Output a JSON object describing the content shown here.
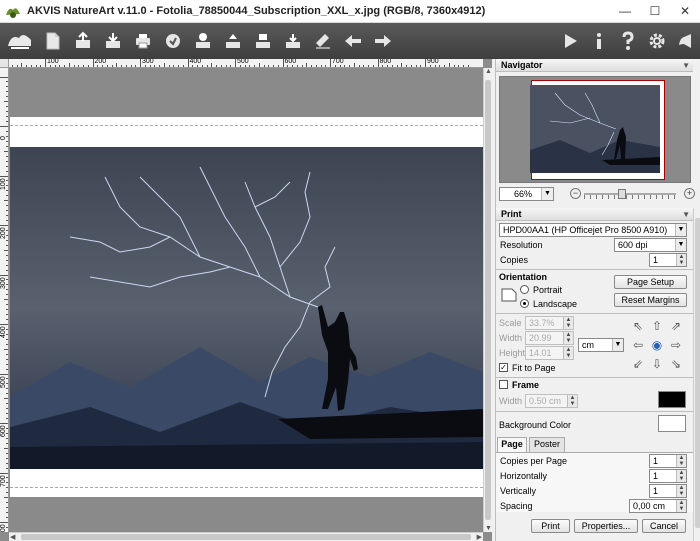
{
  "window": {
    "title": "AKVIS NatureArt v.11.0 - Fotolia_78850044_Subscription_XXL_x.jpg (RGB/8, 7360x4912)",
    "minimize": "—",
    "maximize": "☐",
    "close": "✕"
  },
  "toolbar": {
    "left_icons": [
      "open-icon",
      "save-icon",
      "batch-icon",
      "print-icon",
      "share-icon",
      "import-icon",
      "export-icon",
      "paste-icon",
      "copy-icon",
      "brush-settings-icon",
      "undo-arrow-icon",
      "redo-arrow-icon"
    ],
    "right_icons": [
      "run-icon",
      "info-icon",
      "help-icon",
      "settings-icon",
      "news-icon"
    ]
  },
  "ruler": {
    "h_labels": [
      "100",
      "200",
      "300",
      "400",
      "500",
      "600",
      "700",
      "800",
      "900"
    ],
    "v_labels": [
      "0",
      "100",
      "200",
      "300",
      "400",
      "500",
      "600",
      "700",
      "800"
    ]
  },
  "navigator": {
    "title": "Navigator",
    "zoom": "66%",
    "zoom_minus": "−",
    "zoom_plus": "+"
  },
  "print": {
    "title": "Print",
    "printer": "HPD00AA1 (HP Officejet Pro 8500 A910)",
    "resolution_label": "Resolution",
    "resolution_value": "600 dpi",
    "copies_label": "Copies",
    "copies_value": "1",
    "orientation_label": "Orientation",
    "portrait_label": "Portrait",
    "landscape_label": "Landscape",
    "orientation_selected": "Landscape",
    "page_setup": "Page Setup",
    "reset_margins": "Reset Margins",
    "scale_label": "Scale",
    "scale_value": "33.7%",
    "width_label": "Width",
    "width_value": "20.99",
    "height_label": "Height",
    "height_value": "14.01",
    "unit": "cm",
    "fit_to_page_label": "Fit to Page",
    "fit_to_page": true,
    "frame_label": "Frame",
    "frame_width_label": "Width",
    "frame_width_value": "0.50 cm",
    "frame_color": "#000000",
    "background_color_label": "Background Color",
    "background_color": "#ffffff",
    "tab_page": "Page",
    "tab_poster": "Poster",
    "copies_per_page_label": "Copies per Page",
    "copies_per_page_value": "1",
    "horizontally_label": "Horizontally",
    "horizontally_value": "1",
    "vertically_label": "Vertically",
    "vertically_value": "1",
    "spacing_label": "Spacing",
    "spacing_value": "0,00 cm",
    "print_button": "Print",
    "properties_button": "Properties...",
    "cancel_button": "Cancel"
  }
}
